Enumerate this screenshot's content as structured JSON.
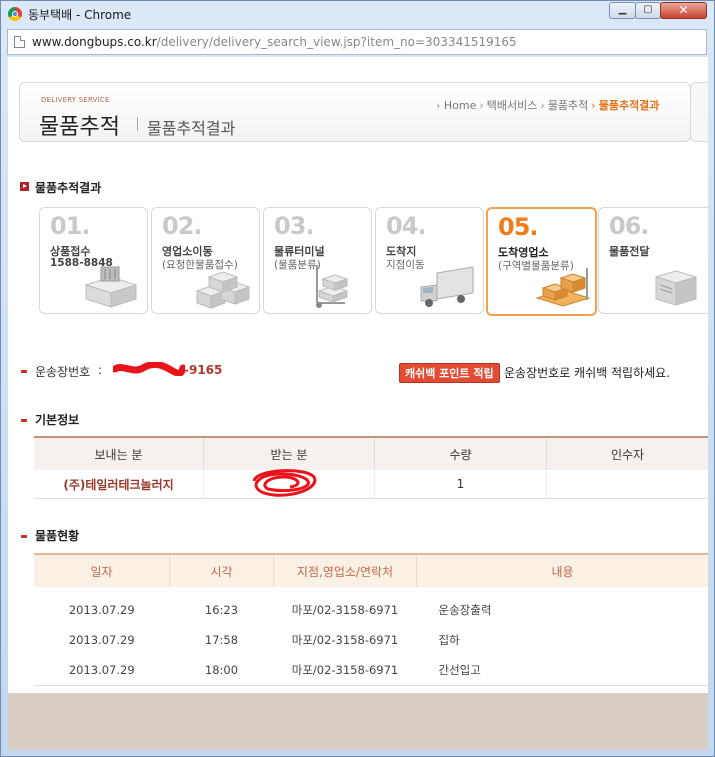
{
  "window": {
    "title": "동부택배 - Chrome",
    "url_host": "www.dongbups.co.kr",
    "url_path": "/delivery/delivery_search_view.jsp?item_no=303341519165"
  },
  "header": {
    "service_label": "DELIVERY SERVICE",
    "title": "물품추적",
    "subtitle": "물품추적결과",
    "breadcrumb": [
      "Home",
      "택배서비스",
      "물품추적",
      "물품추적결과"
    ]
  },
  "sections": {
    "result_title": "물품추적결과",
    "basic_info_title": "기본정보",
    "status_title": "물품현황"
  },
  "steps": [
    {
      "num": "01.",
      "name": "상품접수",
      "sub": "1588-8848",
      "active": false
    },
    {
      "num": "02.",
      "name": "영업소이동",
      "sub": "(요청한물품접수)",
      "active": false
    },
    {
      "num": "03.",
      "name": "물류터미널",
      "sub": "(물품분류)",
      "active": false
    },
    {
      "num": "04.",
      "name": "도착지",
      "sub": "지점이동",
      "active": false
    },
    {
      "num": "05.",
      "name": "도착영업소",
      "sub": "(구역별물품분류)",
      "active": true
    },
    {
      "num": "06.",
      "name": "물품전달",
      "sub": "",
      "active": false
    }
  ],
  "waybill": {
    "label": "운송장번호",
    "colon": ":",
    "visible_tail": "-9165",
    "cashback_button": "캐쉬백 포인트 적립",
    "cashback_text": "운송장번호로 캐쉬백 적립하세요."
  },
  "basic_info": {
    "headers": [
      "보내는 분",
      "받는 분",
      "수량",
      "인수자"
    ],
    "row": {
      "sender": "(주)테일러테크놀러지",
      "recipient": "",
      "qty": "1",
      "receiver": ""
    }
  },
  "status": {
    "headers": [
      "일자",
      "시각",
      "지점,영업소/연락처",
      "내용"
    ],
    "rows": [
      {
        "date": "2013.07.29",
        "time": "16:23",
        "branch": "마포/02-3158-6971",
        "desc": "운송장출력"
      },
      {
        "date": "2013.07.29",
        "time": "17:58",
        "branch": "마포/02-3158-6971",
        "desc": "집하"
      },
      {
        "date": "2013.07.29",
        "time": "18:00",
        "branch": "마포/02-3158-6971",
        "desc": "간선입고"
      }
    ]
  },
  "colors": {
    "accent": "#f07c1a",
    "brand_red": "#b0252a",
    "redaction": "#e8141c"
  }
}
